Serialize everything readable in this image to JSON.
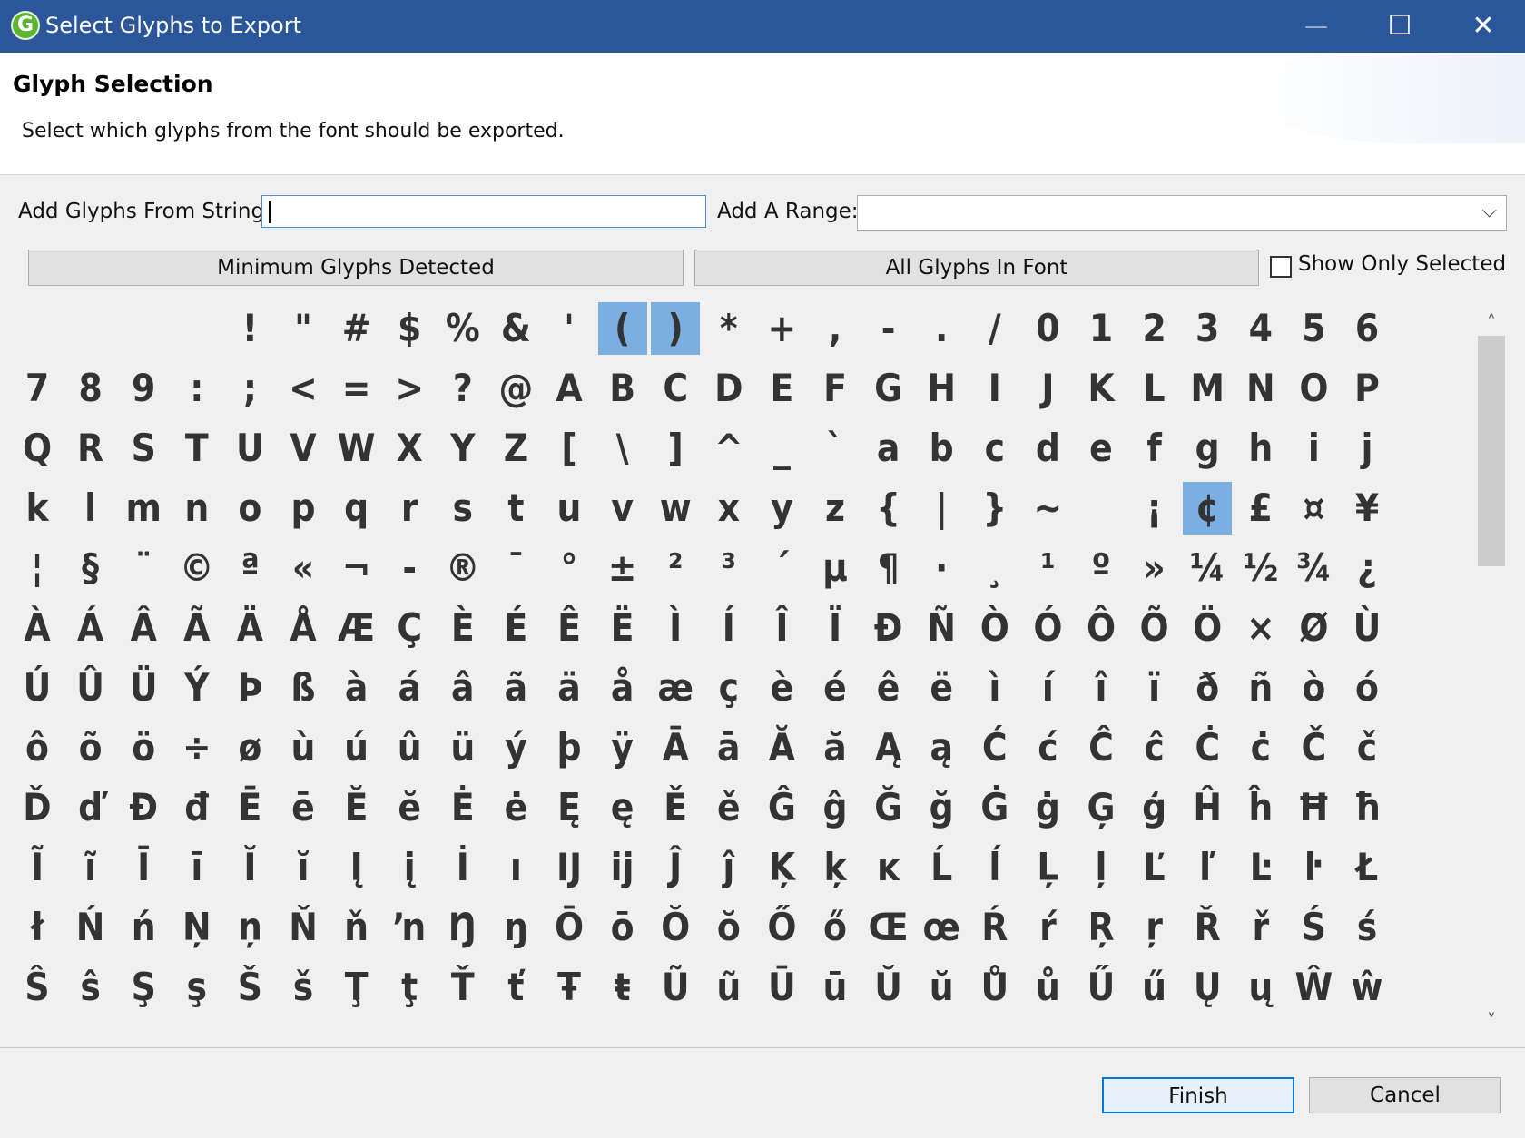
{
  "window": {
    "title": "Select Glyphs to Export",
    "app_icon_letter": "G",
    "minimize_glyph": "—",
    "maximize_glyph": "☐",
    "close_glyph": "✕"
  },
  "header": {
    "title": "Glyph Selection",
    "subtitle": "Select which glyphs from the font should be exported."
  },
  "controls": {
    "add_string_label": "Add Glyphs From String:",
    "add_string_value": "",
    "add_range_label": "Add A Range:",
    "add_range_value": "",
    "range_chevron": "⌵",
    "min_glyphs_label": "Minimum Glyphs Detected",
    "all_glyphs_label": "All Glyphs In Font",
    "show_only_selected_label": "Show Only Selected",
    "show_only_selected_checked": false
  },
  "glyph_rows": [
    [
      " ",
      " ",
      " ",
      " ",
      "!",
      "\"",
      "#",
      "$",
      "%",
      "&",
      "'",
      "(",
      ")",
      "*",
      "+",
      ",",
      "-",
      ".",
      "/",
      "0",
      "1",
      "2",
      "3",
      "4",
      "5",
      "6"
    ],
    [
      "7",
      "8",
      "9",
      ":",
      ";",
      "<",
      "=",
      ">",
      "?",
      "@",
      "A",
      "B",
      "C",
      "D",
      "E",
      "F",
      "G",
      "H",
      "I",
      "J",
      "K",
      "L",
      "M",
      "N",
      "O",
      "P"
    ],
    [
      "Q",
      "R",
      "S",
      "T",
      "U",
      "V",
      "W",
      "X",
      "Y",
      "Z",
      "[",
      "\\",
      "]",
      "^",
      "_",
      "`",
      "a",
      "b",
      "c",
      "d",
      "e",
      "f",
      "g",
      "h",
      "i",
      "j"
    ],
    [
      "k",
      "l",
      "m",
      "n",
      "o",
      "p",
      "q",
      "r",
      "s",
      "t",
      "u",
      "v",
      "w",
      "x",
      "y",
      "z",
      "{",
      "|",
      "}",
      "~",
      " ",
      "¡",
      "¢",
      "£",
      "¤",
      "¥"
    ],
    [
      "¦",
      "§",
      "¨",
      "©",
      "ª",
      "«",
      "¬",
      "-",
      "®",
      "¯",
      "°",
      "±",
      "²",
      "³",
      "´",
      "µ",
      "¶",
      "·",
      "¸",
      "¹",
      "º",
      "»",
      "¼",
      "½",
      "¾",
      "¿"
    ],
    [
      "À",
      "Á",
      "Â",
      "Ã",
      "Ä",
      "Å",
      "Æ",
      "Ç",
      "È",
      "É",
      "Ê",
      "Ë",
      "Ì",
      "Í",
      "Î",
      "Ï",
      "Ð",
      "Ñ",
      "Ò",
      "Ó",
      "Ô",
      "Õ",
      "Ö",
      "×",
      "Ø",
      "Ù"
    ],
    [
      "Ú",
      "Û",
      "Ü",
      "Ý",
      "Þ",
      "ß",
      "à",
      "á",
      "â",
      "ã",
      "ä",
      "å",
      "æ",
      "ç",
      "è",
      "é",
      "ê",
      "ë",
      "ì",
      "í",
      "î",
      "ï",
      "ð",
      "ñ",
      "ò",
      "ó"
    ],
    [
      "ô",
      "õ",
      "ö",
      "÷",
      "ø",
      "ù",
      "ú",
      "û",
      "ü",
      "ý",
      "þ",
      "ÿ",
      "Ā",
      "ā",
      "Ă",
      "ă",
      "Ą",
      "ą",
      "Ć",
      "ć",
      "Ĉ",
      "ĉ",
      "Ċ",
      "ċ",
      "Č",
      "č"
    ],
    [
      "Ď",
      "ď",
      "Đ",
      "đ",
      "Ē",
      "ē",
      "Ĕ",
      "ĕ",
      "Ė",
      "ė",
      "Ę",
      "ę",
      "Ě",
      "ě",
      "Ĝ",
      "ĝ",
      "Ğ",
      "ğ",
      "Ġ",
      "ġ",
      "Ģ",
      "ģ",
      "Ĥ",
      "ĥ",
      "Ħ",
      "ħ"
    ],
    [
      "Ĩ",
      "ĩ",
      "Ī",
      "ī",
      "Ĭ",
      "ĭ",
      "Į",
      "į",
      "İ",
      "ı",
      "Ĳ",
      "ĳ",
      "Ĵ",
      "ĵ",
      "Ķ",
      "ķ",
      "ĸ",
      "Ĺ",
      "ĺ",
      "Ļ",
      "ļ",
      "Ľ",
      "ľ",
      "Ŀ",
      "ŀ",
      "Ł"
    ],
    [
      "ł",
      "Ń",
      "ń",
      "Ņ",
      "ņ",
      "Ň",
      "ň",
      "ŉ",
      "Ŋ",
      "ŋ",
      "Ō",
      "ō",
      "Ŏ",
      "ŏ",
      "Ő",
      "ő",
      "Œ",
      "œ",
      "Ŕ",
      "ŕ",
      "Ŗ",
      "ŗ",
      "Ř",
      "ř",
      "Ś",
      "ś"
    ],
    [
      "Ŝ",
      "ŝ",
      "Ş",
      "ş",
      "Š",
      "š",
      "Ţ",
      "ţ",
      "Ť",
      "ť",
      "Ŧ",
      "ŧ",
      "Ũ",
      "ũ",
      "Ū",
      "ū",
      "Ŭ",
      "ŭ",
      "Ů",
      "ů",
      "Ű",
      "ű",
      "Ų",
      "ų",
      "Ŵ",
      "ŵ"
    ]
  ],
  "selected_glyphs": [
    "(",
    ")",
    "¢"
  ],
  "scrollbar": {
    "up_arrow": "˄",
    "down_arrow": "˅"
  },
  "footer": {
    "finish_label": "Finish",
    "cancel_label": "Cancel"
  },
  "colors": {
    "titlebar": "#2b579a",
    "selection": "#7bafe1",
    "glyph": "#333333",
    "finish_border": "#0078d7"
  }
}
